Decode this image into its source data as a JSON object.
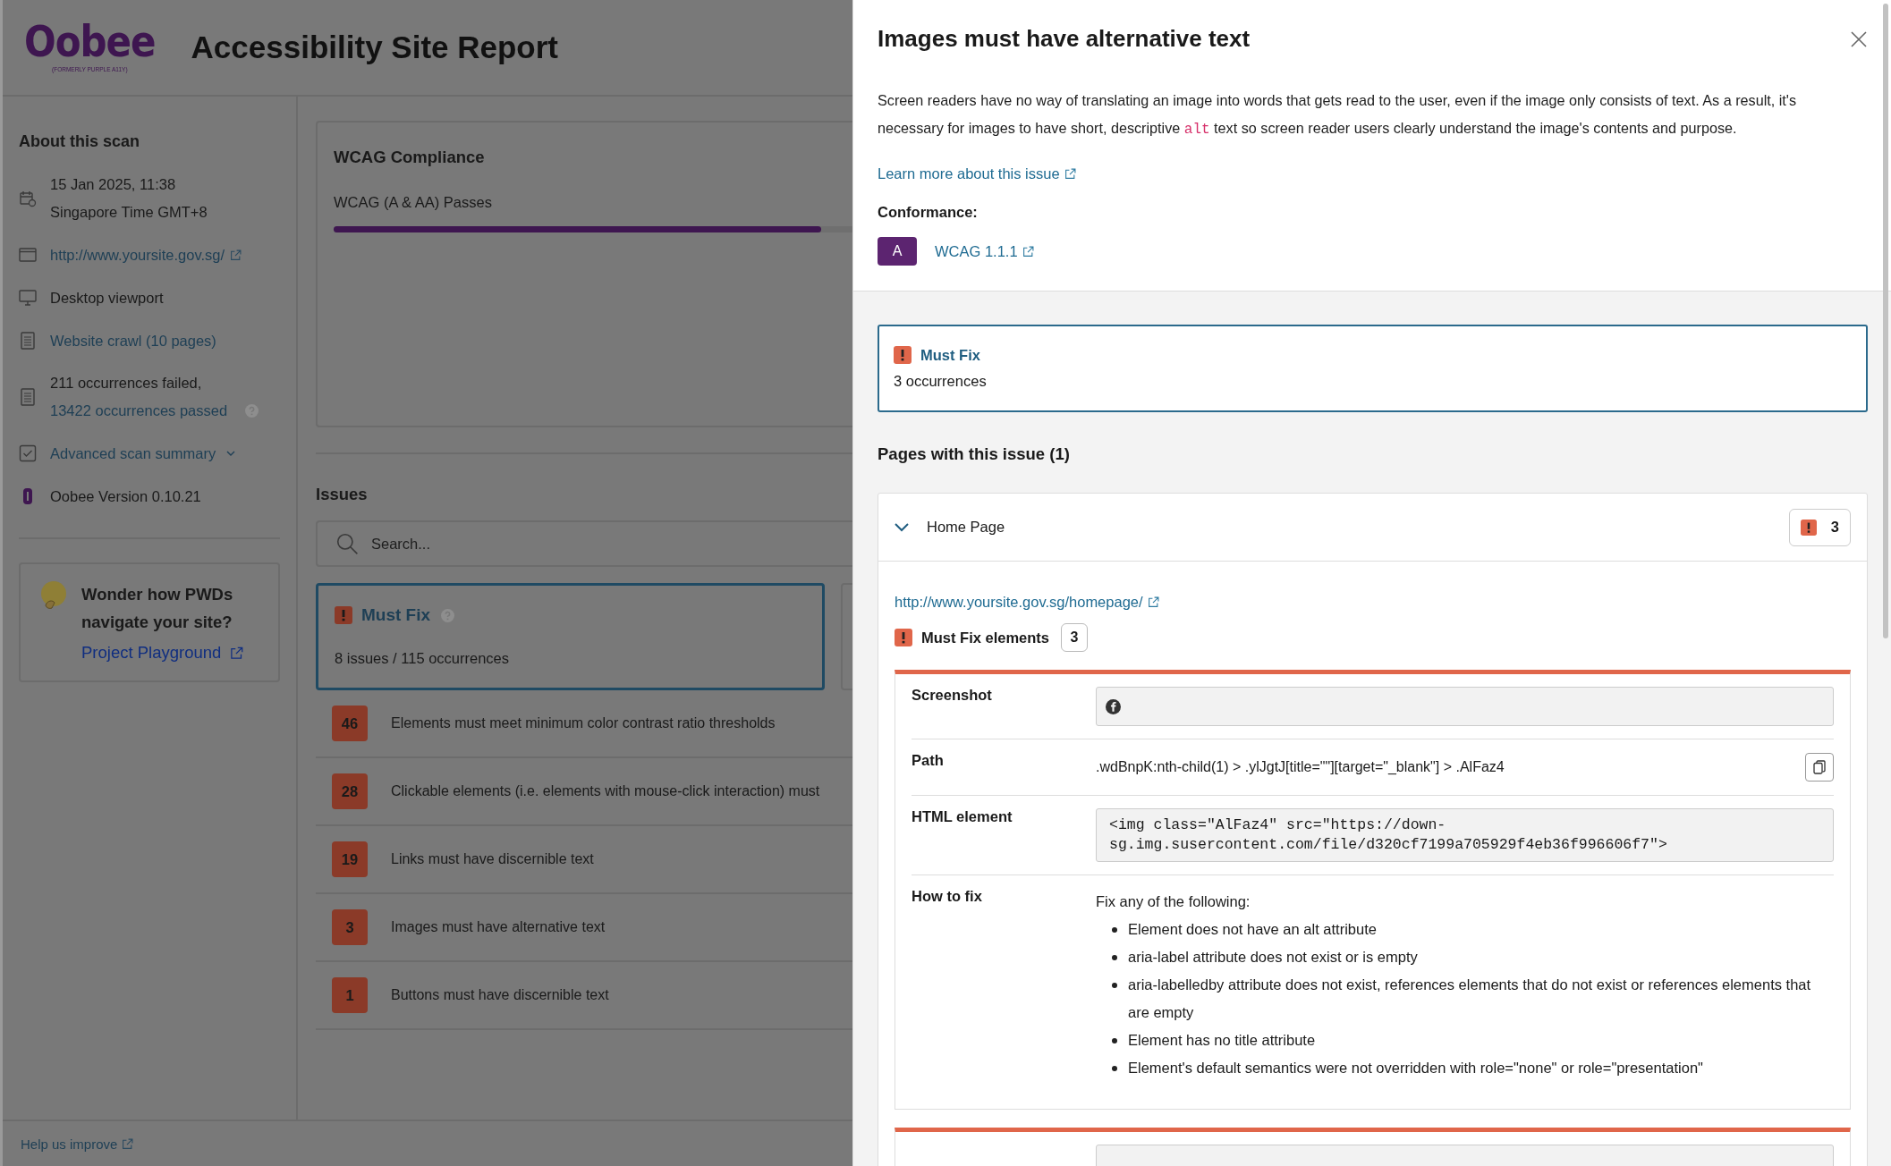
{
  "header": {
    "logo": "Oobee",
    "logo_tagline": "(FORMERLY PURPLE A11Y)",
    "title": "Accessibility Site Report"
  },
  "sidebar": {
    "heading": "About this scan",
    "items": [
      {
        "kind": "calendar",
        "lines": [
          {
            "text": "15 Jan 2025, 11:38",
            "link": false
          },
          {
            "text": "Singapore Time GMT+8",
            "link": false
          }
        ]
      },
      {
        "kind": "browser",
        "lines": [
          {
            "text": "http://www.yoursite.gov.sg/",
            "link": true,
            "external": true
          }
        ]
      },
      {
        "kind": "monitor",
        "lines": [
          {
            "text": "Desktop viewport",
            "link": false
          }
        ]
      },
      {
        "kind": "document",
        "lines": [
          {
            "text": "Website crawl (10 pages)",
            "link": true
          }
        ]
      },
      {
        "kind": "document",
        "lines": [
          {
            "text": "211 occurrences failed,",
            "link": false
          },
          {
            "text": "13422 occurrences passed",
            "link": true,
            "help": true
          }
        ]
      },
      {
        "kind": "checkbox",
        "lines": [
          {
            "text": "Advanced scan summary",
            "link": true,
            "dropdown": true
          }
        ]
      },
      {
        "kind": "logo",
        "lines": [
          {
            "text": "Oobee Version 0.10.21",
            "link": false
          }
        ]
      }
    ],
    "promo": {
      "text": "Wonder how PWDs navigate your site?",
      "link": "Project Playground"
    },
    "footer_link": "Help us improve"
  },
  "compliance": {
    "title": "WCAG Compliance",
    "label": "WCAG (A & AA) Passes",
    "level": 0.94
  },
  "issues": {
    "heading": "Issues",
    "search": {
      "placeholder": "Search..."
    },
    "categories": [
      {
        "title": "Must Fix",
        "summary": "8 issues / 115 occurrences",
        "selected": true
      }
    ],
    "rows": [
      {
        "count": "46",
        "text": "Elements must meet minimum color contrast ratio thresholds"
      },
      {
        "count": "28",
        "text": "Clickable elements (i.e. elements with mouse-click interaction) must"
      },
      {
        "count": "19",
        "text": "Links must have discernible text"
      },
      {
        "count": "3",
        "text": "Images must have alternative text"
      },
      {
        "count": "1",
        "text": "Buttons must have discernible text"
      }
    ]
  },
  "drawer": {
    "title": "Images must have alternative text",
    "description": [
      {
        "kind": "text",
        "text": "Screen readers have no way of translating an image into words that gets read to the user, even if the image only consists of text. As a result, it's necessary for images to have short, descriptive "
      },
      {
        "kind": "code",
        "text": "alt"
      },
      {
        "kind": "text",
        "text": " text so screen reader users clearly understand the image's contents and purpose."
      }
    ],
    "learn_more": "Learn more about this issue",
    "conformance": {
      "label": "Conformance:",
      "badge": "A",
      "link": "WCAG 1.1.1"
    },
    "severity": {
      "title": "Must Fix",
      "occurrences": "3 occurrences"
    },
    "pages_heading": "Pages with this issue (1)",
    "pages": [
      {
        "name": "Home Page",
        "expanded": true,
        "count": "3",
        "url": "http://www.yoursite.gov.sg/homepage/",
        "elements_label": "Must Fix elements",
        "elements_count": "3",
        "elements": [
          {
            "rows": [
              {
                "kind": "screenshot",
                "label": "Screenshot"
              },
              {
                "kind": "path",
                "label": "Path",
                "value": ".wdBnpK:nth-child(1) > .ylJgtJ[title=\"\"][target=\"_blank\"] > .AlFaz4"
              },
              {
                "kind": "code",
                "label": "HTML element",
                "value": "<img class=\"AlFaz4\" src=\"https://down-sg.img.susercontent.com/file/d320cf7199a705929f4eb36f996606f7\">"
              },
              {
                "kind": "list",
                "label": "How to fix",
                "intro": "Fix any of the following:",
                "items": [
                  "Element does not have an alt attribute",
                  "aria-label attribute does not exist or is empty",
                  "aria-labelledby attribute does not exist, references elements that do not exist or references elements that are empty",
                  "Element has no title attribute",
                  "Element's default semantics were not overridden with role=\"none\" or role=\"presentation\""
                ]
              }
            ]
          },
          {
            "rows": [
              {
                "kind": "screenshot"
              }
            ]
          }
        ]
      }
    ]
  }
}
